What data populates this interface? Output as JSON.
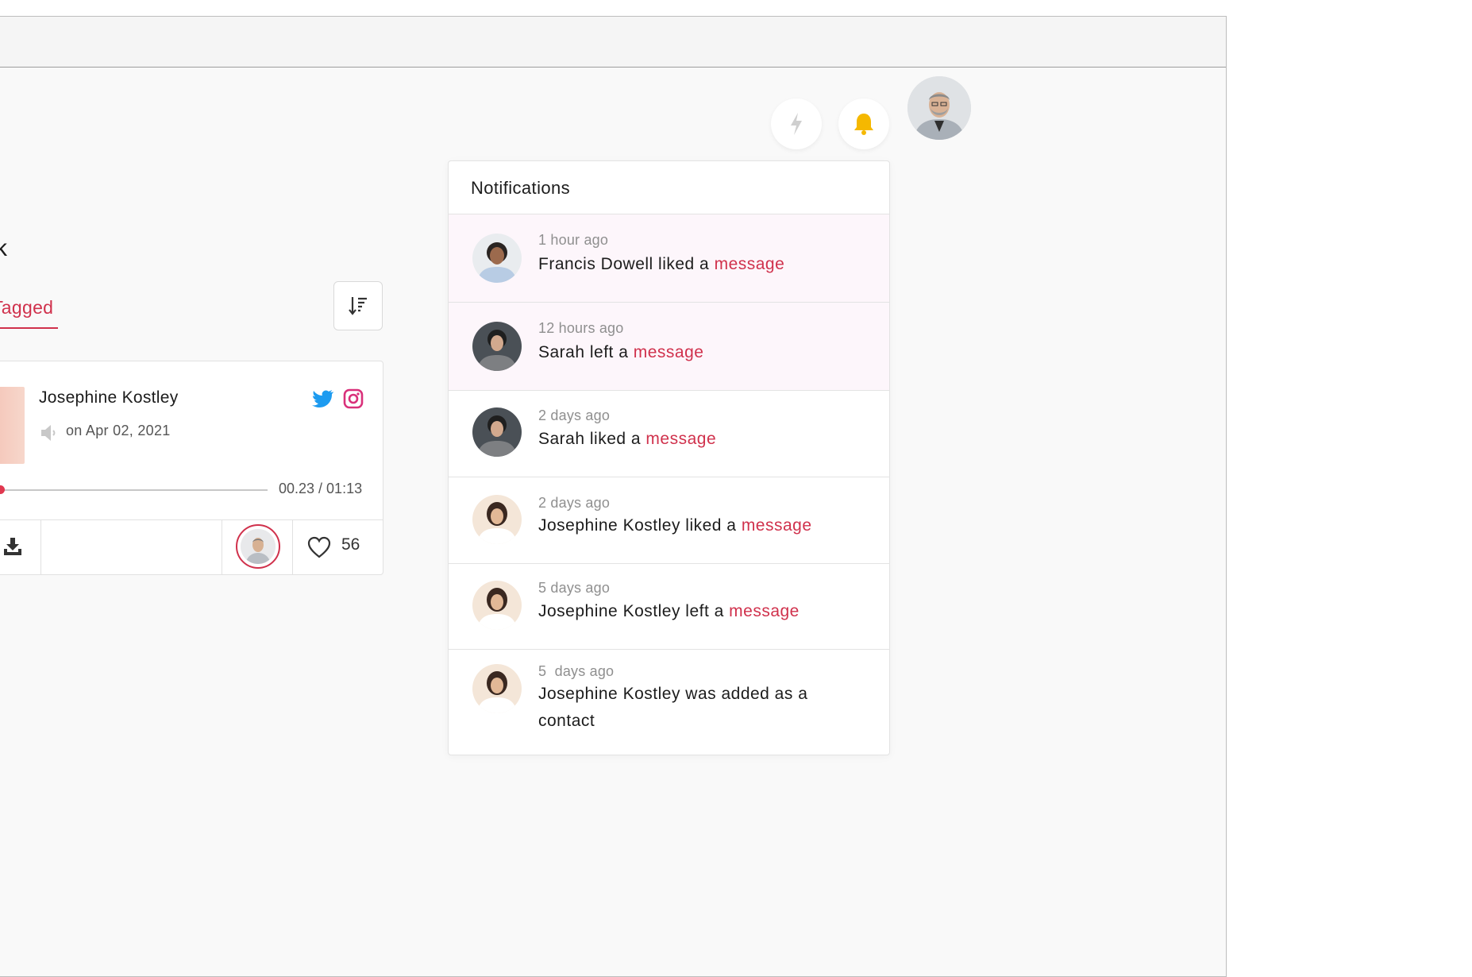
{
  "header": {
    "flash_icon": "lightning-icon",
    "bell_icon": "bell-icon",
    "bell_color": "#f5b800",
    "user_avatar": "user-avatar"
  },
  "page": {
    "heading_fragment": "k",
    "tab_label": "Tagged",
    "accent_color": "#d0314c"
  },
  "card": {
    "name": "Josephine Kostley",
    "date": "on Apr 02, 2021",
    "progress": 0.0,
    "time": "00.23 / 01:13",
    "likes": "56",
    "icons": [
      "twitter-icon",
      "instagram-icon",
      "speaker-icon",
      "download-icon",
      "heart-icon",
      "sort-icon"
    ]
  },
  "notifications": {
    "title": "Notifications",
    "items": [
      {
        "time": "1 hour ago",
        "text": "Francis Dowell liked a ",
        "link": "message",
        "unread": true
      },
      {
        "time": "12 hours ago",
        "text": "Sarah left a ",
        "link": "message",
        "unread": true
      },
      {
        "time": "2 days ago",
        "text": "Sarah liked a ",
        "link": "message",
        "unread": false
      },
      {
        "time": "2 days ago",
        "text": "Josephine Kostley liked a ",
        "link": "message",
        "unread": false
      },
      {
        "time": "5 days ago",
        "text": "Josephine Kostley left a ",
        "link": "message",
        "unread": false
      },
      {
        "time": "5  days ago",
        "text": "Josephine Kostley was added as a contact",
        "link": "",
        "unread": false
      }
    ]
  }
}
